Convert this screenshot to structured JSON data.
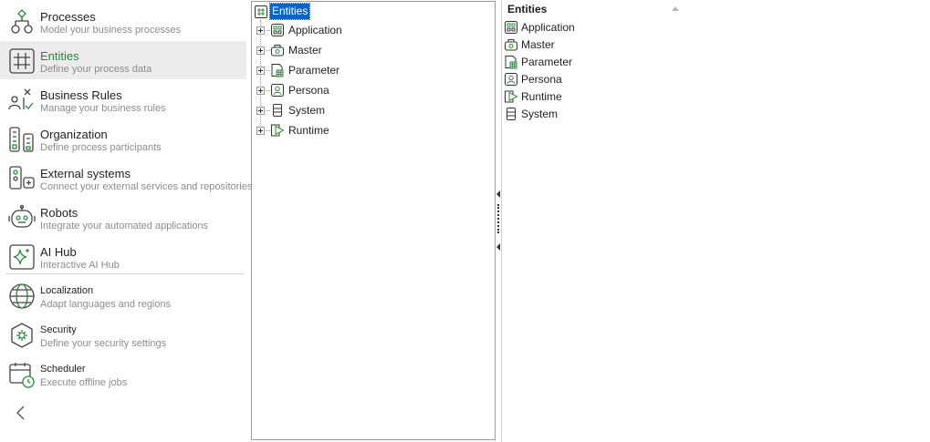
{
  "sidebar": {
    "items": [
      {
        "title": "Processes",
        "desc": "Model your business processes",
        "icon": "process-flow-icon"
      },
      {
        "title": "Entities",
        "desc": "Define your process data",
        "icon": "entities-grid-icon",
        "active": true
      },
      {
        "title": "Business Rules",
        "desc": "Manage your business rules",
        "icon": "business-rules-icon"
      },
      {
        "title": "Organization",
        "desc": "Define process participants",
        "icon": "organization-icon"
      },
      {
        "title": "External systems",
        "desc": "Connect your external services and repositories",
        "icon": "external-systems-icon"
      },
      {
        "title": "Robots",
        "desc": "Integrate your automated applications",
        "icon": "robot-icon"
      },
      {
        "title": "AI Hub",
        "desc": "Interactive AI Hub",
        "icon": "ai-sparkle-icon"
      },
      {
        "title": "Localization",
        "desc": "Adapt languages and regions",
        "icon": "globe-icon"
      },
      {
        "title": "Security",
        "desc": "Define your security settings",
        "icon": "security-gear-icon"
      },
      {
        "title": "Scheduler",
        "desc": "Execute offline jobs",
        "icon": "calendar-clock-icon"
      }
    ],
    "collapse_icon": "chevron-left-icon"
  },
  "tree": {
    "root_label": "Entities",
    "children": [
      {
        "label": "Application",
        "icon": "application-icon"
      },
      {
        "label": "Master",
        "icon": "master-icon"
      },
      {
        "label": "Parameter",
        "icon": "parameter-icon"
      },
      {
        "label": "Persona",
        "icon": "persona-icon"
      },
      {
        "label": "System",
        "icon": "system-icon"
      },
      {
        "label": "Runtime",
        "icon": "runtime-icon"
      }
    ]
  },
  "list": {
    "header": "Entities",
    "items": [
      {
        "label": "Application",
        "icon": "application-icon"
      },
      {
        "label": "Master",
        "icon": "master-icon"
      },
      {
        "label": "Parameter",
        "icon": "parameter-icon"
      },
      {
        "label": "Persona",
        "icon": "persona-icon"
      },
      {
        "label": "Runtime",
        "icon": "runtime-icon"
      },
      {
        "label": "System",
        "icon": "system-icon"
      }
    ]
  },
  "colors": {
    "accent": "#2e8b3e",
    "active_text": "#1e8a3c",
    "selection": "#0a64c8"
  }
}
